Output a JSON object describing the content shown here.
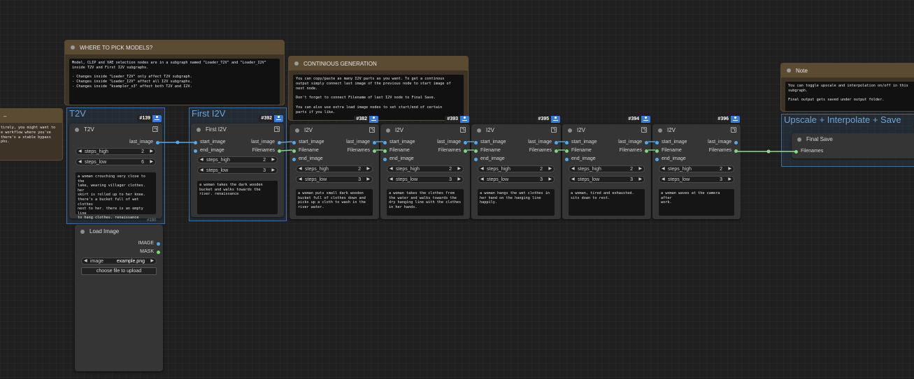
{
  "notes": {
    "left": "tirely, you might want to\ne workflow where you've\nthere's a stable bypass\nphs.",
    "models": {
      "title": "WHERE TO PICK MODELS?",
      "body": "Model, CLIP and VAE selection nodes are in a subgraph named \"Loader_T2V\" and \"Loader_I2V\"\ninside T2V and First I2V subgraphs.\n\n- Changes inside \"Loader_T2V\" only affect T2V subgraph.\n- Changes inside \"Loader_I2V\" affect all I2V subgraphs.\n- Changes inside \"ksampler_x3\" affect both T2V and I2V."
    },
    "generation": {
      "title": "CONTINIOUS GENERATION",
      "body": "You can copy/paste as many I2V parts as you want. To get a continous\noutput simply connect last image of the previous node to start image of\nnext node.\n\nDon't forget to connect Filename of last I2V node to Final Save.\n\nYou can also use extra load image nodes to set start/end of certain\nparts if you like."
    },
    "right": {
      "title": "Note",
      "body": "You can toggle upscale and interpolation on/off in this\nsubgraph.\n\nFinal output gets saved under output folder."
    }
  },
  "groups": {
    "t2v": "T2V",
    "first_i2v": "First I2V",
    "upscale": "Upscale + Interpolate + Save"
  },
  "labels": {
    "start_image": "start_image",
    "end_image": "end_image",
    "last_image": "last_image",
    "filename": "Filename",
    "filenames": "Filenames",
    "steps_high": "steps_high",
    "steps_low": "steps_low"
  },
  "nodes": {
    "t2v": {
      "id": "#139",
      "title": "T2V",
      "steps_high": "2",
      "steps_low": "6",
      "prompt": "a woman crouching very close to the\nlake, wearing villager clothes. her\nskirt is rolled up to her knee.\nthere's a bucket full of wet clothes\nnext to her. there is an empty line\nto hang clothes. renaissance",
      "footer": "#180"
    },
    "first_i2v": {
      "id": "#392",
      "title": "First I2V",
      "steps_high": "2",
      "steps_low": "3",
      "prompt": "a woman takes the dark wooden\nbucket and walks towards the\nriver. renaissance"
    },
    "i2v_1": {
      "id": "#382",
      "title": "I2V",
      "steps_high": "2",
      "steps_low": "3",
      "prompt": "a woman puts small dark wooden\nbucket full of clothes down and\npicks up a cloth to wash in the\nriver water."
    },
    "i2v_2": {
      "id": "#393",
      "title": "I2V",
      "steps_high": "2",
      "steps_low": "3",
      "prompt": "a woman takes the clothes from\nthe water and walks towards the\ndry hanging line with the clothes\nin her hands."
    },
    "i2v_3": {
      "id": "#395",
      "title": "I2V",
      "steps_high": "2",
      "steps_low": "3",
      "prompt": "a woman hangs the wet clothes in\nher hand on the hanging line\nhappily."
    },
    "i2v_4": {
      "id": "#394",
      "title": "I2V",
      "steps_high": "2",
      "steps_low": "3",
      "prompt": "a woman, tired and exhausted.\nsits down to rest."
    },
    "i2v_5": {
      "id": "#396",
      "title": "I2V",
      "steps_high": "2",
      "steps_low": "3",
      "prompt": "a woman waves at the camera after\nwork."
    },
    "load_image": {
      "title": "Load Image",
      "out_image": "IMAGE",
      "out_mask": "MASK",
      "image_label": "image",
      "image_value": "example.png",
      "upload_label": "choose file to upload"
    },
    "final_save": {
      "title": "Final Save",
      "in_filenames": "Filenames",
      "id": "#"
    }
  }
}
